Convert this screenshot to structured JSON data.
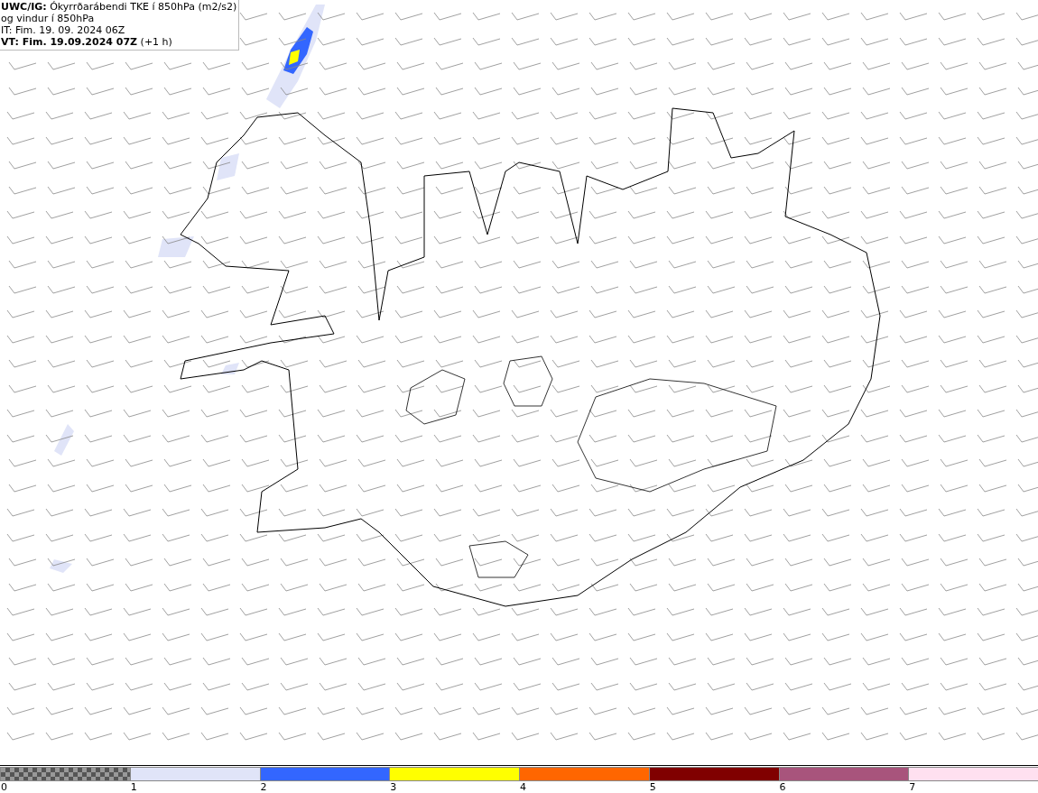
{
  "header": {
    "lines": [
      "**UWC/IG:** Ókyrrðarábendi TKE í 850hPa (m2/s2)",
      "og vindur í 850hPa",
      "IT: Fim. 19. 09. 2024 06Z",
      "**VT: Fim. 19.09.2024 07Z** (+1 h)"
    ]
  },
  "legend": {
    "segments": [
      {
        "kind": "checker"
      },
      {
        "kind": "solid",
        "color": "#e0e4f8"
      },
      {
        "kind": "solid",
        "color": "#3366ff"
      },
      {
        "kind": "solid",
        "color": "#ffff00"
      },
      {
        "kind": "solid",
        "color": "#ff6600"
      },
      {
        "kind": "solid",
        "color": "#800000"
      },
      {
        "kind": "solid",
        "color": "#a8547c"
      },
      {
        "kind": "solid",
        "color": "#ffe0f0"
      }
    ],
    "labels": [
      "0",
      "1",
      "2",
      "3",
      "4",
      "5",
      "6",
      "7"
    ]
  }
}
